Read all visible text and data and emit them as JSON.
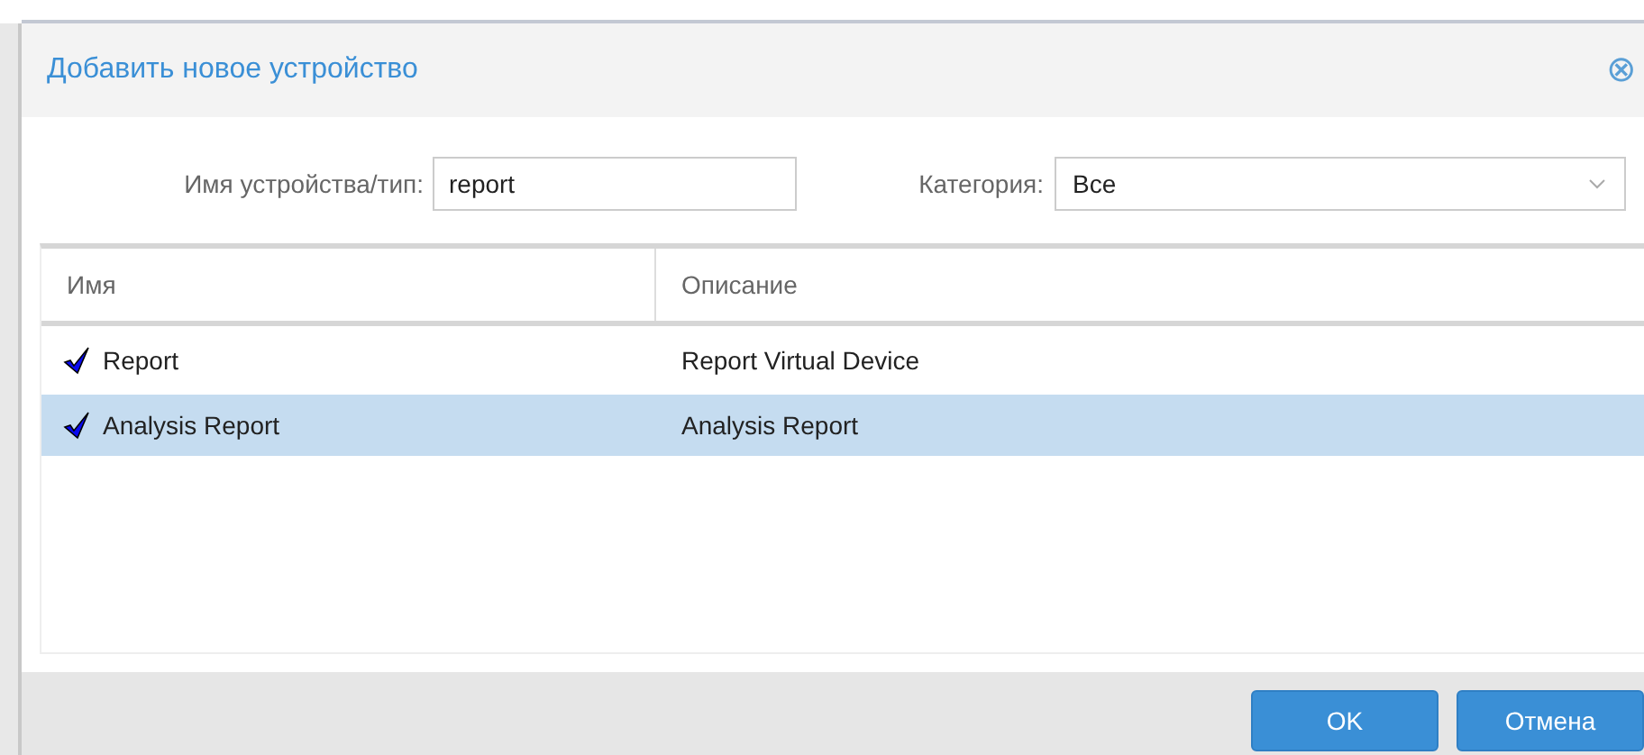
{
  "dialog": {
    "title": "Добавить новое устройство",
    "close": "⊗"
  },
  "filters": {
    "name_label": "Имя устройства/тип:",
    "name_value": "report",
    "category_label": "Категория:",
    "category_value": "Все"
  },
  "table": {
    "columns": [
      "Имя",
      "Описание"
    ],
    "rows": [
      {
        "name": "Report",
        "description": "Report Virtual Device",
        "selected": false
      },
      {
        "name": "Analysis Report",
        "description": "Analysis Report",
        "selected": true
      }
    ]
  },
  "buttons": [
    "OK",
    "Отмена"
  ]
}
